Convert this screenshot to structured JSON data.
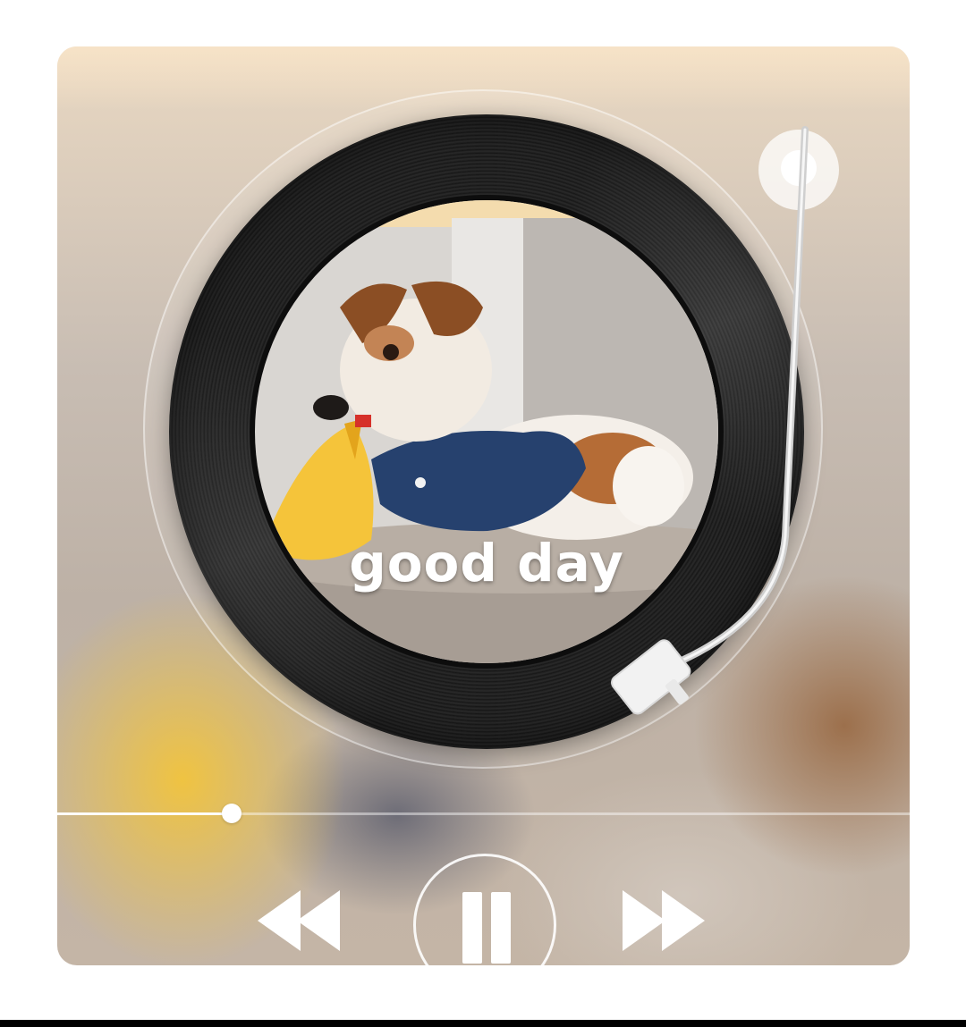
{
  "player": {
    "track_title": "good day",
    "progress": 0.205,
    "controls": {
      "rewind_icon": "rewind-icon",
      "play_pause_icon": "pause-icon",
      "forward_icon": "fast-forward-icon"
    }
  },
  "colors": {
    "accent": "#ffffff",
    "vinyl": "#1a1a1a"
  }
}
